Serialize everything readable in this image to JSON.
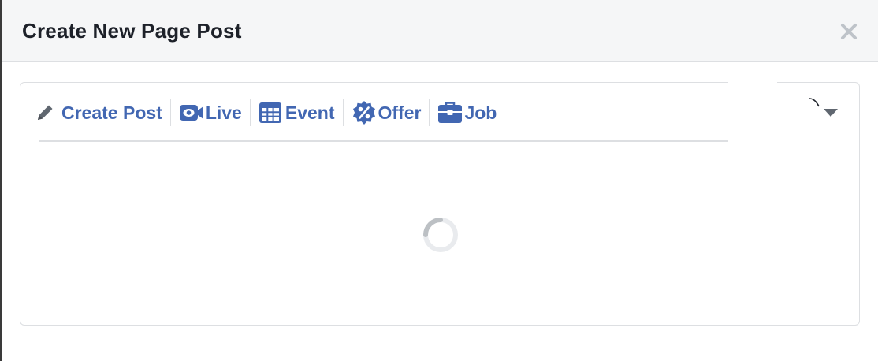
{
  "dialog": {
    "title": "Create New Page Post",
    "close_icon": "close-icon"
  },
  "composer": {
    "tabs": [
      {
        "label": "Create Post",
        "icon": "pencil-icon"
      },
      {
        "label": "Live",
        "icon": "video-camera-icon"
      },
      {
        "label": "Event",
        "icon": "calendar-icon"
      },
      {
        "label": "Offer",
        "icon": "offer-badge-icon"
      },
      {
        "label": "Job",
        "icon": "briefcase-icon"
      }
    ],
    "more_icon": "caret-down-icon",
    "status": "loading"
  },
  "colors": {
    "accent": "#4267b2",
    "header_bg": "#f5f6f7",
    "border": "#dddfe2",
    "title_text": "#1d2129",
    "icon_grey": "#606770"
  }
}
